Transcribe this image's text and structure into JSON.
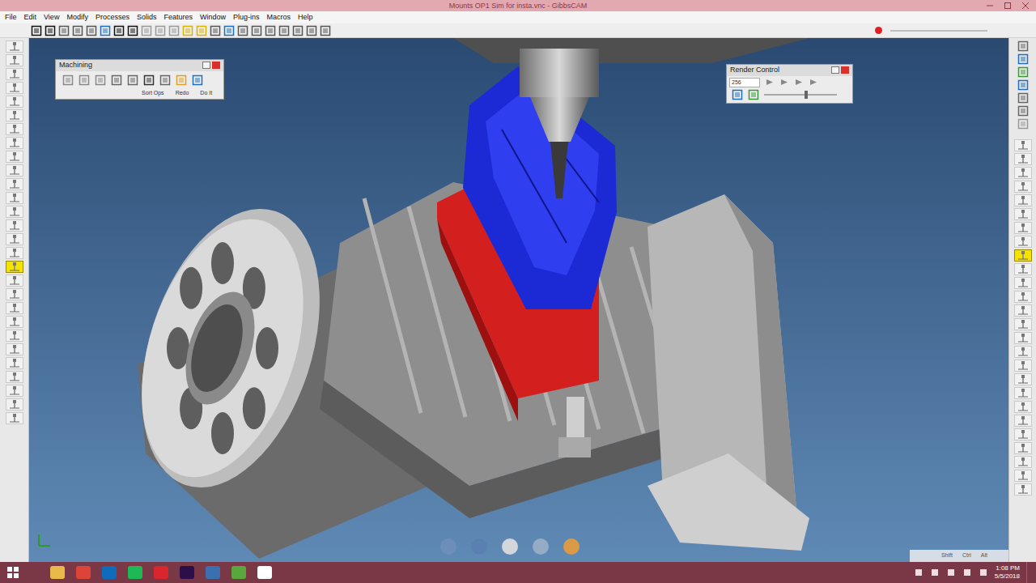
{
  "window": {
    "title": "Mounts OP1 Sim for insta.vnc - GibbsCAM"
  },
  "menu": [
    "File",
    "Edit",
    "View",
    "Modify",
    "Processes",
    "Solids",
    "Features",
    "Window",
    "Plug-ins",
    "Macros",
    "Help"
  ],
  "machining_palette": {
    "title": "Machining",
    "buttons": [
      "Sort Ops",
      "Redo",
      "Do It"
    ]
  },
  "render_control": {
    "title": "Render Control",
    "field": "256",
    "level": 0.55
  },
  "left_tools": [
    {
      "selected": false
    },
    {
      "selected": false
    },
    {
      "selected": false
    },
    {
      "selected": false
    },
    {
      "selected": false
    },
    {
      "selected": false
    },
    {
      "selected": false
    },
    {
      "selected": false
    },
    {
      "selected": false
    },
    {
      "selected": false
    },
    {
      "selected": false
    },
    {
      "selected": false
    },
    {
      "selected": false
    },
    {
      "selected": false
    },
    {
      "selected": false
    },
    {
      "selected": false
    },
    {
      "selected": true
    },
    {
      "selected": false
    },
    {
      "selected": false
    },
    {
      "selected": false
    },
    {
      "selected": false
    },
    {
      "selected": false
    },
    {
      "selected": false
    },
    {
      "selected": false
    },
    {
      "selected": false
    },
    {
      "selected": false
    },
    {
      "selected": false
    },
    {
      "selected": false
    }
  ],
  "right_tools": [
    {
      "selected": false
    },
    {
      "selected": false
    },
    {
      "selected": false
    },
    {
      "selected": false
    },
    {
      "selected": false
    },
    {
      "selected": false
    },
    {
      "selected": false
    },
    {
      "selected": false
    },
    {
      "selected": true
    },
    {
      "selected": false
    },
    {
      "selected": false
    },
    {
      "selected": false
    },
    {
      "selected": false
    },
    {
      "selected": false
    },
    {
      "selected": false
    },
    {
      "selected": false
    },
    {
      "selected": false
    },
    {
      "selected": false
    },
    {
      "selected": false
    },
    {
      "selected": false
    },
    {
      "selected": false
    },
    {
      "selected": false
    },
    {
      "selected": false
    },
    {
      "selected": false
    },
    {
      "selected": false
    },
    {
      "selected": false
    }
  ],
  "modifier_keys": [
    "Shift",
    "Ctrl",
    "Alt"
  ],
  "taskbar": {
    "time": "1:08 PM",
    "date": "5/5/2018"
  }
}
